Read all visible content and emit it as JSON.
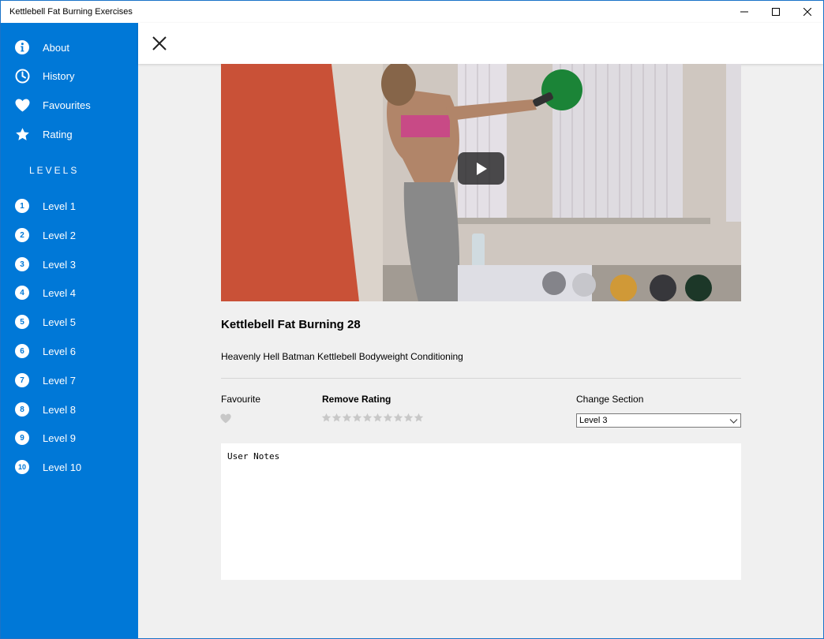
{
  "window": {
    "title": "Kettlebell Fat Burning Exercises"
  },
  "sidebar": {
    "menu": [
      {
        "label": "About",
        "icon": "info-icon"
      },
      {
        "label": "History",
        "icon": "clock-icon"
      },
      {
        "label": "Favourites",
        "icon": "heart-icon"
      },
      {
        "label": "Rating",
        "icon": "star-icon"
      }
    ],
    "levels_heading": "LEVELS",
    "levels": [
      {
        "num": "1",
        "label": "Level 1"
      },
      {
        "num": "2",
        "label": "Level 2"
      },
      {
        "num": "3",
        "label": "Level 3"
      },
      {
        "num": "4",
        "label": "Level 4"
      },
      {
        "num": "5",
        "label": "Level 5"
      },
      {
        "num": "6",
        "label": "Level 6"
      },
      {
        "num": "7",
        "label": "Level 7"
      },
      {
        "num": "8",
        "label": "Level 8"
      },
      {
        "num": "9",
        "label": "Level 9"
      },
      {
        "num": "10",
        "label": "Level 10"
      }
    ]
  },
  "exercise": {
    "title": "Kettlebell Fat Burning 28",
    "description": "Heavenly Hell Batman Kettlebell Bodyweight Conditioning"
  },
  "controls": {
    "favourite_label": "Favourite",
    "rating_label": "Remove Rating",
    "rating_max": 10,
    "rating_value": 0,
    "section_label": "Change Section",
    "section_selected": "Level 3"
  },
  "notes": {
    "placeholder": "User Notes"
  },
  "colors": {
    "accent": "#0078d7",
    "background": "#f0f0f0",
    "star_inactive": "#c8c8c8"
  }
}
